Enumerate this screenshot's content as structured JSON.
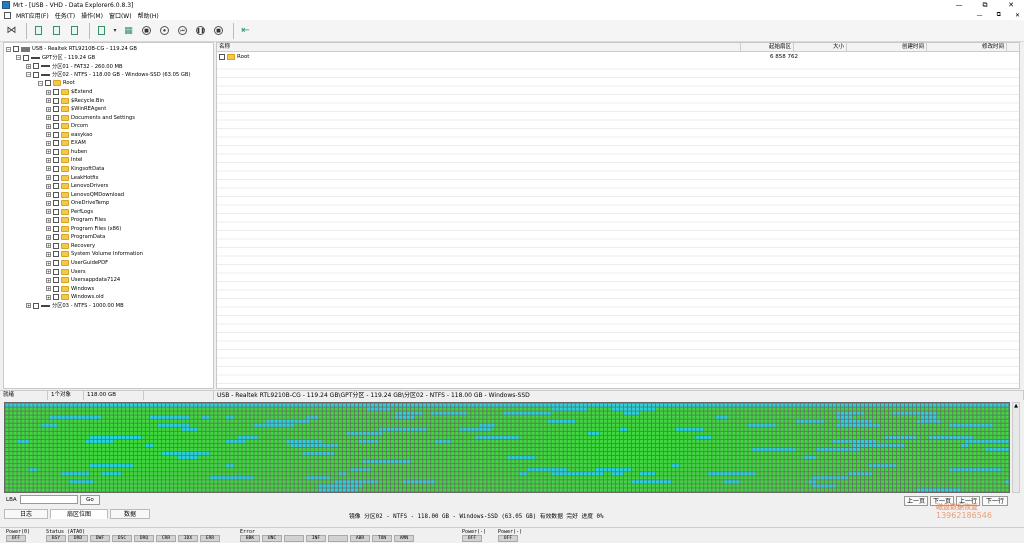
{
  "window": {
    "title": "Mrt - [USB - VHD - Data Explorer6.0.8.3]",
    "minimize": "—",
    "maximize": "⧉",
    "close": "✕"
  },
  "menu": {
    "items": [
      "MRT应用(F)",
      "任务(T)",
      "操作(M)",
      "窗口(W)",
      "帮助(H)"
    ],
    "right": [
      "—",
      "⧉",
      "✕"
    ]
  },
  "toolbar": {
    "buttons": [
      "back-arrow",
      "document",
      "document",
      "document",
      "dropdown-document",
      "chip",
      "stop-circle",
      "pause-circle",
      "prev-circle",
      "pause-circle",
      "stop-circle",
      "exit"
    ]
  },
  "tree": {
    "nodes": [
      {
        "label": "USB - Realtek RTL9210B-CG - 119.24 GB",
        "kind": "disk",
        "level": 0
      },
      {
        "label": "GPT分区 - 119.24 GB",
        "kind": "part",
        "level": 1
      },
      {
        "label": "分区01 - FAT32 - 260.00 MB",
        "kind": "part",
        "level": 2
      },
      {
        "label": "分区02 - NTFS - 118.00 GB - Windows-SSD (63.05 GB)",
        "kind": "part",
        "level": 2
      },
      {
        "label": "Root",
        "kind": "folder",
        "level": 3
      },
      {
        "label": "$Extend",
        "kind": "folder",
        "level": 4
      },
      {
        "label": "$Recycle.Bin",
        "kind": "folder",
        "level": 4
      },
      {
        "label": "$WinREAgent",
        "kind": "folder",
        "level": 4
      },
      {
        "label": "Documents and Settings",
        "kind": "folder",
        "level": 4
      },
      {
        "label": "Drcom",
        "kind": "folder",
        "level": 4
      },
      {
        "label": "easykao",
        "kind": "folder",
        "level": 4
      },
      {
        "label": "EXAM",
        "kind": "folder",
        "level": 4
      },
      {
        "label": "huben",
        "kind": "folder",
        "level": 4
      },
      {
        "label": "Intel",
        "kind": "folder",
        "level": 4
      },
      {
        "label": "KingsoftData",
        "kind": "folder",
        "level": 4
      },
      {
        "label": "LeakHotfix",
        "kind": "folder",
        "level": 4
      },
      {
        "label": "LenovoDrivers",
        "kind": "folder",
        "level": 4
      },
      {
        "label": "LenovoQMDownload",
        "kind": "folder",
        "level": 4
      },
      {
        "label": "OneDriveTemp",
        "kind": "folder",
        "level": 4
      },
      {
        "label": "PerfLogs",
        "kind": "folder",
        "level": 4
      },
      {
        "label": "Program Files",
        "kind": "folder",
        "level": 4
      },
      {
        "label": "Program Files (x86)",
        "kind": "folder",
        "level": 4
      },
      {
        "label": "ProgramData",
        "kind": "folder",
        "level": 4
      },
      {
        "label": "Recovery",
        "kind": "folder",
        "level": 4
      },
      {
        "label": "System Volume Information",
        "kind": "folder",
        "level": 4
      },
      {
        "label": "UserGuidePDF",
        "kind": "folder",
        "level": 4
      },
      {
        "label": "Users",
        "kind": "folder",
        "level": 4
      },
      {
        "label": "Usersappdata7124",
        "kind": "folder",
        "level": 4
      },
      {
        "label": "Windows",
        "kind": "folder",
        "level": 4
      },
      {
        "label": "Windows.old",
        "kind": "folder",
        "level": 4
      },
      {
        "label": "分区03 - NTFS - 1000.00 MB",
        "kind": "part",
        "level": 2
      }
    ]
  },
  "list": {
    "columns": [
      "名称",
      "起始扇区",
      "大小",
      "创建时间",
      "修改时间"
    ],
    "rows": [
      {
        "name": "Root",
        "start": "6 858 762",
        "size": "",
        "created": "",
        "modified": ""
      }
    ]
  },
  "status": {
    "state": "就绪",
    "count": "1个对象",
    "size": "118.00 GB",
    "path": "USB - Realtek RTL9210B-CG - 119.24 GB\\GPT分区 - 119.24 GB\\分区02 - NTFS - 118.00 GB - Windows-SSD"
  },
  "sector_map": {
    "colors": {
      "used": "#3fd63f",
      "free": "#2ad1d8",
      "border": "#6a6a6a"
    }
  },
  "bottom": {
    "lba_label": "LBA",
    "lba_value": "",
    "go": "Go",
    "tabs": [
      "日志",
      "扇区位图",
      "数据"
    ],
    "active_tab": 1,
    "map_info": "镜像 分区02 - NTFS - 118.00 GB - Windows-SSD (63.05 GB) 有效数据 完好  进度 0%",
    "nav": [
      "上一页",
      "下一页",
      "上一行",
      "下一行"
    ],
    "watermark_line1": "磁盘数据恢复",
    "watermark_line2": "13962186546"
  },
  "leds": {
    "groups": [
      {
        "label": "Power(0)",
        "items": [
          "OFF"
        ]
      },
      {
        "label": "Status (ATA0)",
        "items": [
          "BSY",
          "DRD",
          "DWF",
          "DSC",
          "DRQ",
          "CRR",
          "IDX",
          "ERR"
        ]
      },
      {
        "label": "Error",
        "items": [
          "BBK",
          "UNC",
          "",
          "INF",
          "",
          "ABR",
          "TON",
          "AMN"
        ]
      },
      {
        "label": "Power(-)",
        "items": [
          "OFF"
        ]
      },
      {
        "label": "Power(-)",
        "items": [
          "OFF"
        ]
      }
    ]
  }
}
